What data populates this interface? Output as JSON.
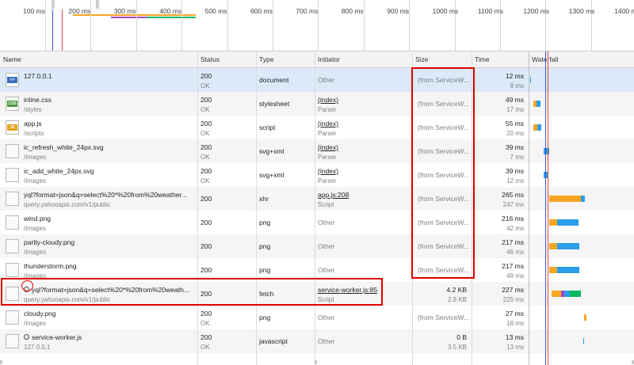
{
  "overview": {
    "ticks": [
      "100 ms",
      "200 ms",
      "300 ms",
      "400 ms",
      "500 ms",
      "600 ms",
      "700 ms",
      "800 ms",
      "900 ms",
      "1000 ms",
      "1100 ms",
      "1200 ms",
      "1300 ms",
      "1400 ms"
    ]
  },
  "columns": {
    "name": "Name",
    "status": "Status",
    "type": "Type",
    "initiator": "Initiator",
    "size": "Size",
    "time": "Time",
    "waterfall": "Waterfall"
  },
  "rows": [
    {
      "name": "127.0.0.1",
      "path": "",
      "status": "200",
      "status_text": "OK",
      "type": "document",
      "initiator": "Other",
      "initiator_sub": "",
      "size": "(from ServiceW...",
      "size2": "",
      "time": "12 ms",
      "latency": "8 ms",
      "icon": "document-icon",
      "badge": "<>",
      "badge_color": "#3b6fbf",
      "selected": true
    },
    {
      "name": "inline.css",
      "path": "/styles",
      "status": "200",
      "status_text": "OK",
      "type": "stylesheet",
      "initiator": "(index)",
      "initiator_sub": "Parser",
      "size": "(from ServiceW...",
      "size2": "",
      "time": "49 ms",
      "latency": "17 ms",
      "icon": "css-file-icon",
      "badge": "CSS",
      "badge_color": "#4a9a3a"
    },
    {
      "name": "app.js",
      "path": "/scripts",
      "status": "200",
      "status_text": "OK",
      "type": "script",
      "initiator": "(index)",
      "initiator_sub": "Parser",
      "size": "(from ServiceW...",
      "size2": "",
      "time": "55 ms",
      "latency": "20 ms",
      "icon": "js-file-icon",
      "badge": "JS",
      "badge_color": "#e3a21a"
    },
    {
      "name": "ic_refresh_white_24px.svg",
      "path": "/images",
      "status": "200",
      "status_text": "OK",
      "type": "svg+xml",
      "initiator": "(index)",
      "initiator_sub": "Parser",
      "size": "(from ServiceW...",
      "size2": "",
      "time": "39 ms",
      "latency": "7 ms",
      "icon": "image-file-icon"
    },
    {
      "name": "ic_add_white_24px.svg",
      "path": "/images",
      "status": "200",
      "status_text": "OK",
      "type": "svg+xml",
      "initiator": "(index)",
      "initiator_sub": "Parser",
      "size": "(from ServiceW...",
      "size2": "",
      "time": "39 ms",
      "latency": "12 ms",
      "icon": "image-file-icon"
    },
    {
      "name": "yql?format=json&q=select%20*%20from%20weather...",
      "path": "query.yahooapis.com/v1/public",
      "status": "200",
      "status_text": "",
      "type": "xhr",
      "initiator": "app.js:208",
      "initiator_sub": "Script",
      "size": "(from ServiceW...",
      "size2": "",
      "time": "265 ms",
      "latency": "247 ms",
      "icon": "blank-file-icon"
    },
    {
      "name": "wind.png",
      "path": "/images",
      "status": "200",
      "status_text": "",
      "type": "png",
      "initiator": "Other",
      "initiator_sub": "",
      "size": "(from ServiceW...",
      "size2": "",
      "time": "216 ms",
      "latency": "42 ms",
      "icon": "image-file-icon"
    },
    {
      "name": "partly-cloudy.png",
      "path": "/images",
      "status": "200",
      "status_text": "",
      "type": "png",
      "initiator": "Other",
      "initiator_sub": "",
      "size": "(from ServiceW...",
      "size2": "",
      "time": "217 ms",
      "latency": "46 ms",
      "icon": "image-file-icon"
    },
    {
      "name": "thunderstorm.png",
      "path": "/images",
      "status": "200",
      "status_text": "",
      "type": "png",
      "initiator": "Other",
      "initiator_sub": "",
      "size": "(from ServiceW...",
      "size2": "",
      "time": "217 ms",
      "latency": "49 ms",
      "icon": "image-file-icon"
    },
    {
      "name": "yql?format=json&q=select%20*%20from%20weath...",
      "path": "query.yahooapis.com/v1/public",
      "status": "200",
      "status_text": "",
      "type": "fetch",
      "initiator": "service-worker.js:85",
      "initiator_sub": "Script",
      "size": "4.2 KB",
      "size2": "2.8 KB",
      "time": "227 ms",
      "latency": "225 ms",
      "icon": "blank-file-icon",
      "gear": true
    },
    {
      "name": "cloudy.png",
      "path": "/images",
      "status": "200",
      "status_text": "OK",
      "type": "png",
      "initiator": "Other",
      "initiator_sub": "",
      "size": "(from ServiceW...",
      "size2": "",
      "time": "27 ms",
      "latency": "18 ms",
      "icon": "image-file-icon"
    },
    {
      "name": "service-worker.js",
      "path": "127.0.0.1",
      "status": "200",
      "status_text": "OK",
      "type": "javascript",
      "initiator": "Other",
      "initiator_sub": "",
      "size": "0 B",
      "size2": "3.5 KB",
      "time": "13 ms",
      "latency": "13 ms",
      "icon": "blank-file-icon",
      "gear": true
    }
  ],
  "colors": {
    "waiting": "#f5a623",
    "receiving": "#2a9ee8",
    "ssl": "#a347c6",
    "download": "#0bb860",
    "dom_content_loaded": "#3355dd",
    "load": "#e24545",
    "annotation": "#e00000"
  }
}
